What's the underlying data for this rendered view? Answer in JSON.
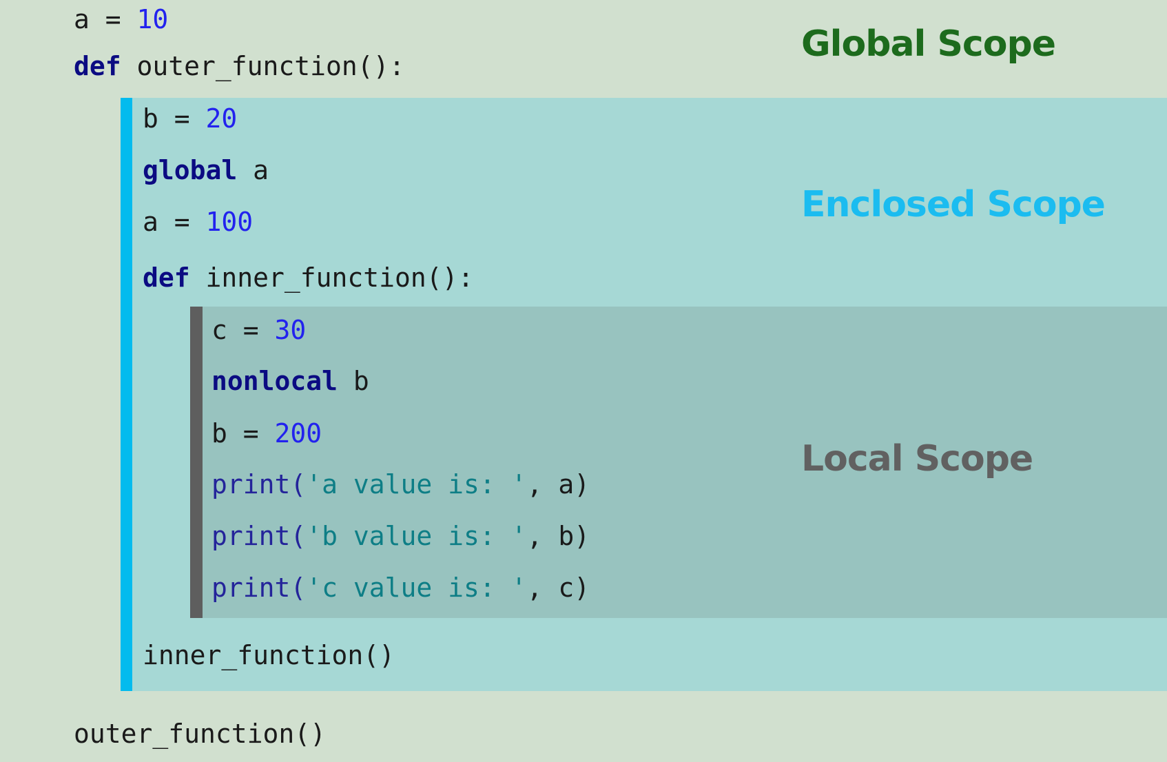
{
  "labels": {
    "global": "Global Scope",
    "enclosed": "Enclosed Scope",
    "local": "Local Scope"
  },
  "code": {
    "global_assign": {
      "var": "a",
      "op": " = ",
      "value": "10"
    },
    "outer_def": {
      "keyword": "def",
      "name": " outer_function():"
    },
    "enclosed_assign_b": {
      "var": "b",
      "op": " = ",
      "value": "20"
    },
    "global_decl": {
      "keyword": "global",
      "var": " a"
    },
    "enclosed_assign_a": {
      "var": "a",
      "op": " = ",
      "value": "100"
    },
    "inner_def": {
      "keyword": "def",
      "name": " inner_function():"
    },
    "local_assign_c": {
      "var": "c",
      "op": " = ",
      "value": "30"
    },
    "nonlocal_decl": {
      "keyword": "nonlocal",
      "var": " b"
    },
    "local_assign_b": {
      "var": "b",
      "op": " = ",
      "value": "200"
    },
    "print_a": {
      "fn": "print(",
      "str": "'a value is: '",
      "rest": ", a)"
    },
    "print_b": {
      "fn": "print(",
      "str": "'b value is: '",
      "rest": ", b)"
    },
    "print_c": {
      "fn": "print(",
      "str": "'c value is: '",
      "rest": ", c)"
    },
    "inner_call": "inner_function()",
    "outer_call": "outer_function()"
  },
  "colors": {
    "background": "#d1e0cf",
    "enclosed_background": "#a6d8d5",
    "enclosed_bar": "#03bbee",
    "local_background": "#98c3bf",
    "local_bar": "#5e5e5e",
    "global_label": "#1d6b1d",
    "enclosed_label": "#1bbcf0",
    "local_label": "#616161",
    "keyword": "#0b0b82",
    "number": "#2222ee",
    "string": "#0e7e86"
  }
}
